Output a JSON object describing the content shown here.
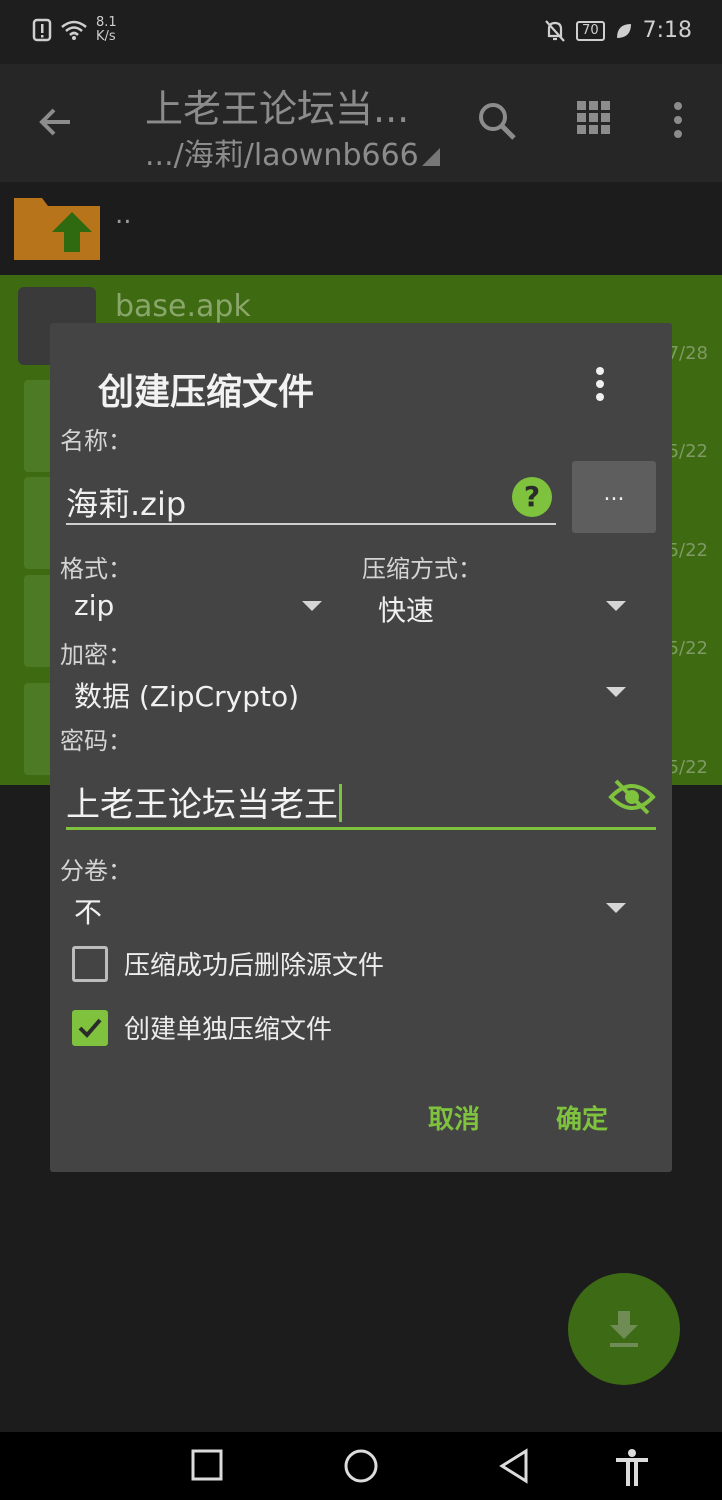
{
  "status_bar": {
    "speed_value": "8.1",
    "speed_unit": "K/s",
    "battery": "70",
    "time": "7:18"
  },
  "appbar": {
    "title": "上老王论坛当...",
    "path": ".../海莉/laownb666"
  },
  "list": {
    "up_label": "..",
    "apk_name": "base.apk",
    "dates": [
      "7/28",
      "5/22",
      "5/22",
      "5/22",
      "5/22"
    ]
  },
  "dialog": {
    "title": "创建压缩文件",
    "name_label": "名称：",
    "name_value": "海莉.zip",
    "help_symbol": "?",
    "browse_label": "...",
    "format_label": "格式：",
    "format_value": "zip",
    "method_label": "压缩方式：",
    "method_value": "快速",
    "encrypt_label": "加密：",
    "encrypt_value": "数据 (ZipCrypto)",
    "password_label": "密码：",
    "password_value": "上老王论坛当老王",
    "volume_label": "分卷：",
    "volume_value": "不",
    "delete_source_label": "压缩成功后删除源文件",
    "delete_source_checked": false,
    "separate_archive_label": "创建单独压缩文件",
    "separate_archive_checked": true,
    "cancel_label": "取消",
    "ok_label": "确定"
  },
  "colors": {
    "accent": "#7ec23e",
    "dialog_bg": "#444444",
    "selection_bg": "#3e6a12"
  }
}
